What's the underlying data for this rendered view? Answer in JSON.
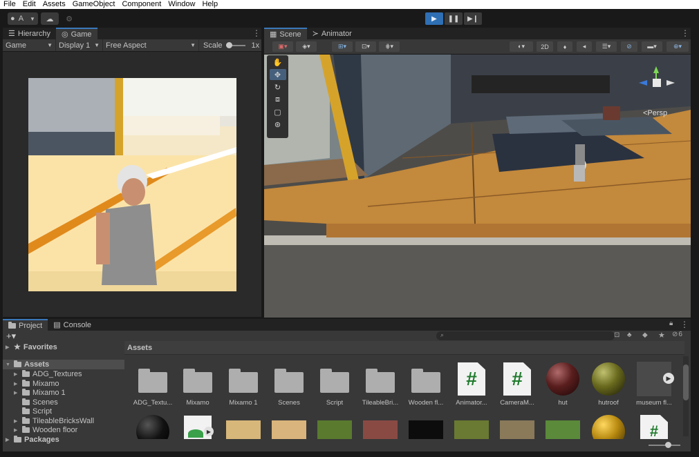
{
  "menu": [
    "File",
    "Edit",
    "Assets",
    "GameObject",
    "Component",
    "Window",
    "Help"
  ],
  "toolbar": {
    "account_label": "A"
  },
  "left_tabs": {
    "hierarchy": "Hierarchy",
    "game": "Game"
  },
  "game_bar": {
    "mode": "Game",
    "display": "Display 1",
    "aspect": "Free Aspect",
    "scale_label": "Scale",
    "scale_value": "1x"
  },
  "scene_tabs": {
    "scene": "Scene",
    "animator": "Animator"
  },
  "scene_bar": {
    "mode_2d": "2D"
  },
  "scene": {
    "persp_label": "<Persp"
  },
  "project_tabs": {
    "project": "Project",
    "console": "Console"
  },
  "project_bar": {
    "hidden_count": "6"
  },
  "tree": {
    "favorites": "Favorites",
    "assets": "Assets",
    "children": [
      "ADG_Textures",
      "Mixamo",
      "Mixamo 1",
      "Scenes",
      "Script",
      "TileableBricksWall",
      "Wooden floor"
    ],
    "packages": "Packages"
  },
  "assets_header": "Assets",
  "asset_row1": [
    {
      "label": "ADG_Textu...",
      "kind": "folder"
    },
    {
      "label": "Mixamo",
      "kind": "folder"
    },
    {
      "label": "Mixamo 1",
      "kind": "folder"
    },
    {
      "label": "Scenes",
      "kind": "folder"
    },
    {
      "label": "Script",
      "kind": "folder"
    },
    {
      "label": "TileableBri...",
      "kind": "folder"
    },
    {
      "label": "Wooden fl...",
      "kind": "folder"
    },
    {
      "label": "Animator...",
      "kind": "script",
      "glyph": "#"
    },
    {
      "label": "CameraM...",
      "kind": "script",
      "glyph": "#"
    },
    {
      "label": "hut",
      "kind": "material",
      "color": "#5a1e1e"
    },
    {
      "label": "hutroof",
      "kind": "material",
      "color": "#6a6a1e"
    },
    {
      "label": "museum fl...",
      "kind": "animation"
    }
  ],
  "colors": {
    "accent": "#3a79bb",
    "play_active": "#2f6fb4",
    "panel": "#383838",
    "script_green": "#1f7a2d"
  }
}
